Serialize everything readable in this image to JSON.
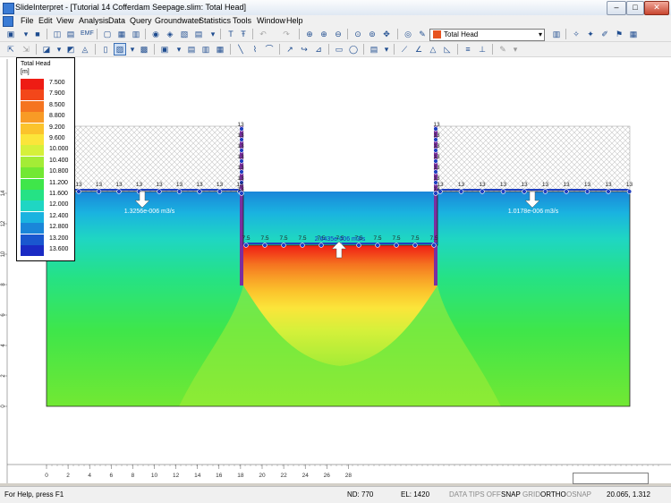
{
  "window": {
    "title": "SlideInterpret - [Tutorial 14 Cofferdam Seepage.slim: Total Head]",
    "min": "‒",
    "max": "□",
    "close": "✕"
  },
  "menu": [
    "File",
    "Edit",
    "View",
    "Analysis",
    "Data",
    "Query",
    "Groundwater",
    "Statistics",
    "Tools",
    "Window",
    "Help"
  ],
  "toolbar": {
    "data_select": "Total Head"
  },
  "legend": {
    "title": "Total Head",
    "unit": "[m]",
    "levels": [
      "7.500",
      "7.900",
      "8.500",
      "8.800",
      "9.200",
      "9.600",
      "10.000",
      "10.400",
      "10.800",
      "11.200",
      "11.600",
      "12.000",
      "12.400",
      "12.800",
      "13.200",
      "13.600"
    ],
    "colors": [
      "#ee1c14",
      "#f3471a",
      "#f57420",
      "#f89b26",
      "#fbc32c",
      "#fbe53a",
      "#d6f03a",
      "#a4ec36",
      "#72e833",
      "#3fe64a",
      "#25e285",
      "#1fd6c3",
      "#1ab3e0",
      "#1a86d9",
      "#1a57cf",
      "#1a2bc4"
    ]
  },
  "flow_labels": {
    "left": "1.3256e-006 m3/s",
    "center": "2.6435e-006 m3/s",
    "right": "1.0178e-006 m3/s"
  },
  "head_labels": {
    "upstream": "13",
    "downstream": "7.5"
  },
  "x_ticks": [
    "0",
    "2",
    "4",
    "6",
    "8",
    "10",
    "12",
    "14",
    "16",
    "18",
    "20",
    "22",
    "24",
    "26",
    "28"
  ],
  "y_ticks": [
    "0",
    "2",
    "4",
    "6",
    "8",
    "10",
    "12",
    "14"
  ],
  "status": {
    "help": "For Help, press F1",
    "nodes": "ND: 770",
    "elements": "EL: 1420",
    "tips": "DATA TIPS OFF",
    "snap": "SNAP",
    "grid": "GRID",
    "ortho": "ORTHO",
    "osnap": "OSNAP",
    "coords": "20.065, 1.312"
  }
}
